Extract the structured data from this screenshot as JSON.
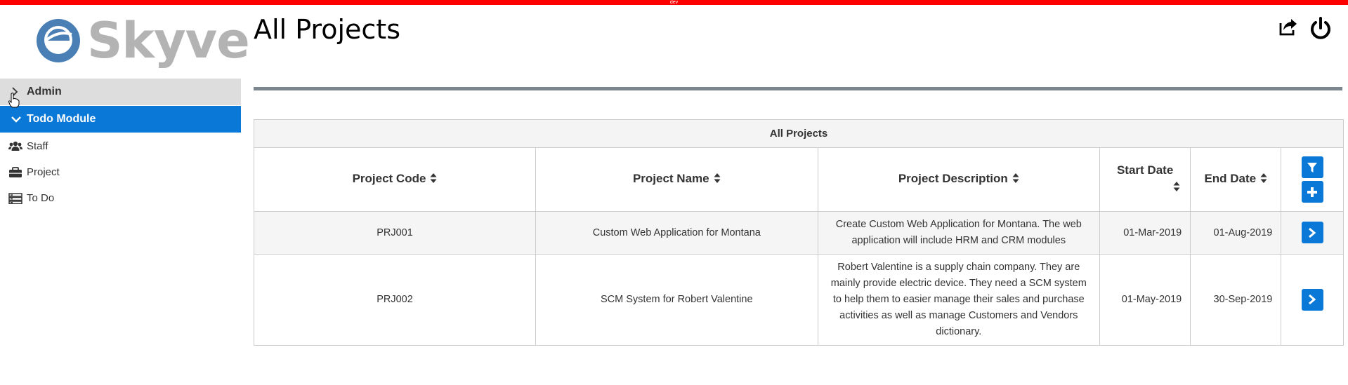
{
  "env_badge": "dev",
  "logo": {
    "text": "Skyve"
  },
  "sidebar": {
    "groups": [
      {
        "label": "Admin",
        "expanded": false,
        "chevron_icon": "chevron-right-icon"
      },
      {
        "label": "Todo Module",
        "expanded": true,
        "chevron_icon": "chevron-down-icon"
      }
    ],
    "items": [
      {
        "label": "Staff",
        "icon": "users-icon"
      },
      {
        "label": "Project",
        "icon": "briefcase-icon"
      },
      {
        "label": "To Do",
        "icon": "list-icon"
      }
    ]
  },
  "header": {
    "title": "All Projects",
    "icons": [
      "share-icon",
      "power-icon"
    ]
  },
  "grid": {
    "caption": "All Projects",
    "columns": [
      "Project Code",
      "Project Name",
      "Project Description",
      "Start Date",
      "End Date"
    ],
    "rows": [
      {
        "code": "PRJ001",
        "name": "Custom Web Application for Montana",
        "description": "Create Custom Web Application for Montana. The web application will include HRM and CRM modules",
        "start": "01-Mar-2019",
        "end": "01-Aug-2019"
      },
      {
        "code": "PRJ002",
        "name": "SCM System for Robert Valentine",
        "description": "Robert Valentine is a supply chain company. They are mainly provide electric device. They need a SCM system to help them to easier manage their sales and purchase activities as well as manage Customers and Vendors dictionary.",
        "start": "01-May-2019",
        "end": "30-Sep-2019"
      }
    ]
  },
  "colors": {
    "accent": "#0a78d7",
    "dev_bar": "#ff0000",
    "admin_bg": "#dddddd",
    "divider": "#7c868e",
    "logo_circle": "#4a7fb5",
    "logo_text": "#b3b3b3"
  }
}
